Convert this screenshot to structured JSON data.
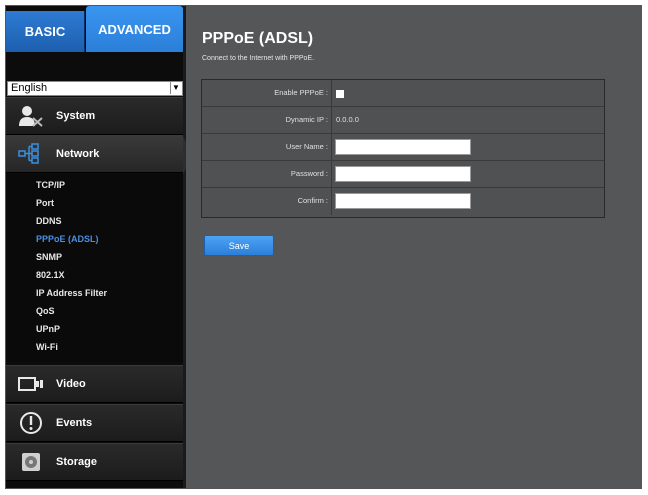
{
  "tabs": {
    "basic": "BASIC",
    "advanced": "ADVANCED"
  },
  "language": {
    "selected": "English"
  },
  "menu": {
    "system": "System",
    "network": "Network",
    "video": "Video",
    "events": "Events",
    "storage": "Storage"
  },
  "network_submenu": [
    "TCP/IP",
    "Port",
    "DDNS",
    "PPPoE (ADSL)",
    "SNMP",
    "802.1X",
    "IP Address Filter",
    "QoS",
    "UPnP",
    "Wi-Fi"
  ],
  "selected_submenu": "PPPoE (ADSL)",
  "page": {
    "title": "PPPoE (ADSL)",
    "subtitle": "Connect to the Internet with PPPoE."
  },
  "form": {
    "enable_label": "Enable PPPoE :",
    "enable_checked": false,
    "dynamic_ip_label": "Dynamic IP :",
    "dynamic_ip_value": "0.0.0.0",
    "username_label": "User Name :",
    "username_value": "",
    "password_label": "Password :",
    "password_value": "",
    "confirm_label": "Confirm :",
    "confirm_value": ""
  },
  "save_label": "Save",
  "colors": {
    "accent": "#2b7fd8",
    "selected_item": "#4a8fe0"
  },
  "icons": {
    "system": "user-wrench-icon",
    "network": "network-icon",
    "video": "camera-icon",
    "events": "alert-icon",
    "storage": "storage-icon"
  }
}
